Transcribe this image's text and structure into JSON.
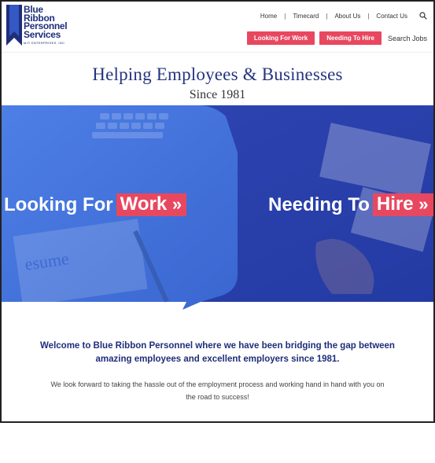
{
  "logo": {
    "lines": [
      "Blue",
      "Ribbon",
      "Personnel",
      "Services"
    ],
    "tagline": "MJT ENTERPRISES, INC.",
    "color": "#1f2e7a"
  },
  "nav": {
    "items": [
      "Home",
      "Timecard",
      "About Us",
      "Contact Us"
    ],
    "separator": "|"
  },
  "buttons": {
    "looking_for_work": "Looking For Work",
    "needing_to_hire": "Needing To Hire",
    "search_jobs": "Search Jobs",
    "accent": "#e8485f"
  },
  "headline": "Helping Employees & Businesses",
  "subline": "Since 1981",
  "hero": {
    "left": {
      "prefix": "Looking For",
      "highlight": "Work",
      "arrow": "»"
    },
    "right": {
      "prefix": "Needing To",
      "highlight": "Hire",
      "arrow": "»"
    },
    "left_color": "#3f6ed8",
    "right_color": "#2a3fae"
  },
  "welcome": "Welcome to Blue Ribbon Personnel where we have been bridging the gap between amazing employees and excellent employers since 1981.",
  "body": "We look forward to taking the hassle out of the employment process and working hand in hand with you on the road to success!"
}
